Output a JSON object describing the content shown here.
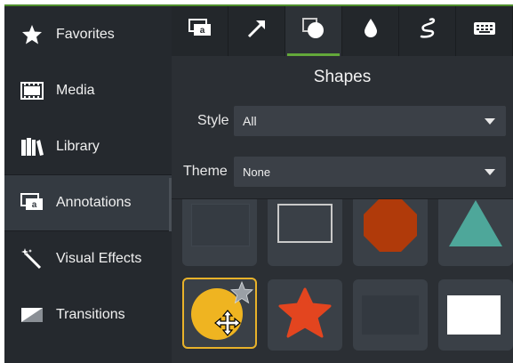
{
  "sidebar": {
    "items": [
      {
        "label": "Favorites",
        "icon": "star-icon"
      },
      {
        "label": "Media",
        "icon": "film-icon"
      },
      {
        "label": "Library",
        "icon": "books-icon"
      },
      {
        "label": "Annotations",
        "icon": "annotation-icon"
      },
      {
        "label": "Visual Effects",
        "icon": "magic-wand-icon"
      },
      {
        "label": "Transitions",
        "icon": "transition-icon"
      }
    ],
    "active_index": 3
  },
  "tabs": [
    {
      "icon": "callout-icon"
    },
    {
      "icon": "arrow-icon"
    },
    {
      "icon": "shape-icon",
      "active": true
    },
    {
      "icon": "blur-drop-icon"
    },
    {
      "icon": "sketch-motion-icon"
    },
    {
      "icon": "keyboard-icon"
    }
  ],
  "panel": {
    "title": "Shapes",
    "style_label": "Style",
    "style_value": "All",
    "theme_label": "Theme",
    "theme_value": "None"
  },
  "shapes": [
    {
      "name": "filled-rectangle"
    },
    {
      "name": "outline-rectangle"
    },
    {
      "name": "octagon",
      "color": "#b03a0a"
    },
    {
      "name": "triangle",
      "color": "#4ea79a"
    },
    {
      "name": "circle-favorite",
      "color": "#efb421",
      "selected": true
    },
    {
      "name": "star",
      "color": "#e3451f"
    },
    {
      "name": "dark-rectangle"
    },
    {
      "name": "white-rectangle",
      "color": "#ffffff"
    }
  ],
  "colors": {
    "accent_green": "#63a83a",
    "selection": "#e8b22a"
  }
}
